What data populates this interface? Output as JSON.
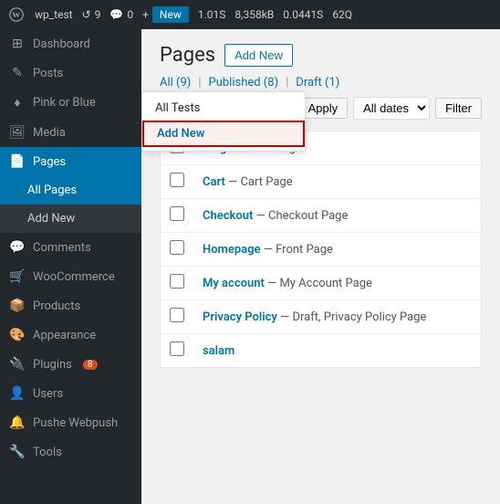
{
  "adminBar": {
    "siteName": "wp_test",
    "updates": "9",
    "comments": "0",
    "newLabel": "+ New",
    "newHighlight": "New",
    "performance": "1.01S",
    "memory": "8,358kB",
    "queryTime": "0.0441S",
    "queries": "62Q"
  },
  "sidebar": {
    "items": [
      {
        "id": "dashboard",
        "label": "Dashboard",
        "icon": "⊞"
      },
      {
        "id": "posts",
        "label": "Posts",
        "icon": "✎"
      },
      {
        "id": "pink-or-blue",
        "label": "Pink or Blue",
        "icon": "♦",
        "active": false
      },
      {
        "id": "media",
        "label": "Media",
        "icon": "🖼"
      },
      {
        "id": "pages",
        "label": "Pages",
        "icon": "📄",
        "active": true
      }
    ],
    "submenu": [
      {
        "id": "all-pages",
        "label": "All Pages",
        "active": true
      },
      {
        "id": "add-new",
        "label": "Add New",
        "active": false
      }
    ],
    "bottomItems": [
      {
        "id": "comments",
        "label": "Comments",
        "icon": "💬"
      },
      {
        "id": "woocommerce",
        "label": "WooCommerce",
        "icon": "🛒"
      },
      {
        "id": "products",
        "label": "Products",
        "icon": "📦"
      },
      {
        "id": "appearance",
        "label": "Appearance",
        "icon": "🎨"
      },
      {
        "id": "plugins",
        "label": "Plugins",
        "icon": "🔌",
        "badge": "8"
      },
      {
        "id": "users",
        "label": "Users",
        "icon": "👤"
      },
      {
        "id": "pushe-webpush",
        "label": "Pushe Webpush",
        "icon": "🔔"
      },
      {
        "id": "tools",
        "label": "Tools",
        "icon": "🔧"
      }
    ]
  },
  "content": {
    "pageTitle": "Pages",
    "addNewLabel": "Add New",
    "filters": {
      "allLabel": "All (9)",
      "publishedLabel": "Published (8)",
      "draftLabel": "Draft (1)"
    },
    "toolbar": {
      "allTestsLabel": "All Tests",
      "applyLabel": "Apply",
      "allDatesLabel": "All dates",
      "filterLabel": "Filter"
    },
    "dropdown": {
      "allTestsLabel": "All Tests",
      "addNewLabel": "Add New"
    },
    "pages": [
      {
        "title": "Blog",
        "desc": "— Posts Page"
      },
      {
        "title": "Cart",
        "desc": "— Cart Page"
      },
      {
        "title": "Checkout",
        "desc": "— Checkout Page"
      },
      {
        "title": "Homepage",
        "desc": "— Front Page"
      },
      {
        "title": "My account",
        "desc": "— My Account Page"
      },
      {
        "title": "Privacy Policy",
        "desc": "— Draft, Privacy Policy Page"
      },
      {
        "title": "salam",
        "desc": ""
      }
    ]
  }
}
